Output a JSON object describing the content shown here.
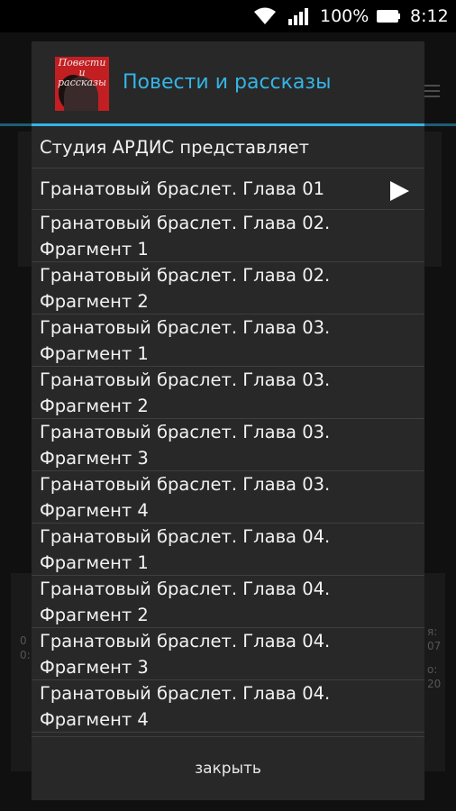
{
  "status_bar": {
    "wifi_icon": "wifi-icon",
    "signal_icon": "signal-icon",
    "battery_percent": "100%",
    "battery_icon": "battery-icon",
    "time": "8:12"
  },
  "background_app": {
    "accent_color": "#1d5d77",
    "fragments": [
      "0",
      "0:",
      "я:",
      "07",
      "о:",
      "20"
    ]
  },
  "dialog": {
    "cover_art": {
      "text": "Повести и рассказы"
    },
    "title": "Повести и рассказы",
    "accent_color": "#33b5e5",
    "tracks": [
      {
        "label": "Студия АРДИС представляет"
      },
      {
        "label": "Гранатовый браслет. Глава 01",
        "playing": true
      },
      {
        "label": "Гранатовый браслет. Глава 02.\nФрагмент 1"
      },
      {
        "label": "Гранатовый браслет. Глава 02.\nФрагмент 2"
      },
      {
        "label": "Гранатовый браслет. Глава 03.\nФрагмент 1"
      },
      {
        "label": "Гранатовый браслет. Глава 03.\nФрагмент 2"
      },
      {
        "label": "Гранатовый браслет. Глава 03.\nФрагмент 3"
      },
      {
        "label": "Гранатовый браслет. Глава 03.\nФрагмент 4"
      },
      {
        "label": "Гранатовый браслет. Глава 04.\nФрагмент 1"
      },
      {
        "label": "Гранатовый браслет. Глава 04.\nФрагмент 2"
      },
      {
        "label": "Гранатовый браслет. Глава 04.\nФрагмент 3"
      },
      {
        "label": "Гранатовый браслет. Глава 04.\nФрагмент 4"
      }
    ],
    "close_label": "закрыть"
  }
}
